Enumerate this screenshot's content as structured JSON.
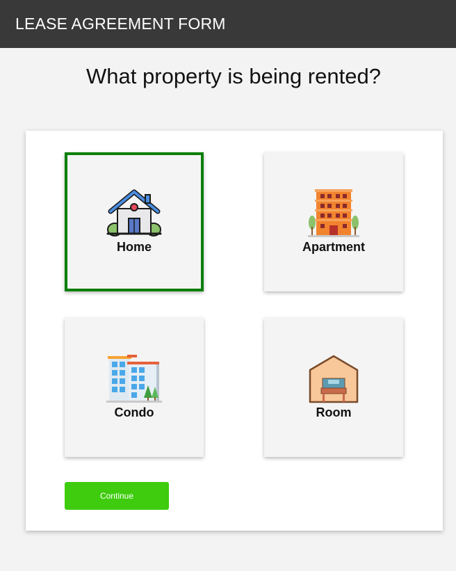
{
  "header": {
    "title": "LEASE AGREEMENT FORM",
    "background_color": "#393939"
  },
  "question": "What property is being rented?",
  "options": [
    {
      "label": "Home",
      "icon": "house-icon",
      "selected": true
    },
    {
      "label": "Apartment",
      "icon": "apartment-building-icon",
      "selected": false
    },
    {
      "label": "Condo",
      "icon": "condo-building-icon",
      "selected": false
    },
    {
      "label": "Room",
      "icon": "room-bed-icon",
      "selected": false
    }
  ],
  "continue_label": "Continue",
  "colors": {
    "selected_border": "#0a7f0a",
    "continue_button": "#3fcc0f"
  }
}
